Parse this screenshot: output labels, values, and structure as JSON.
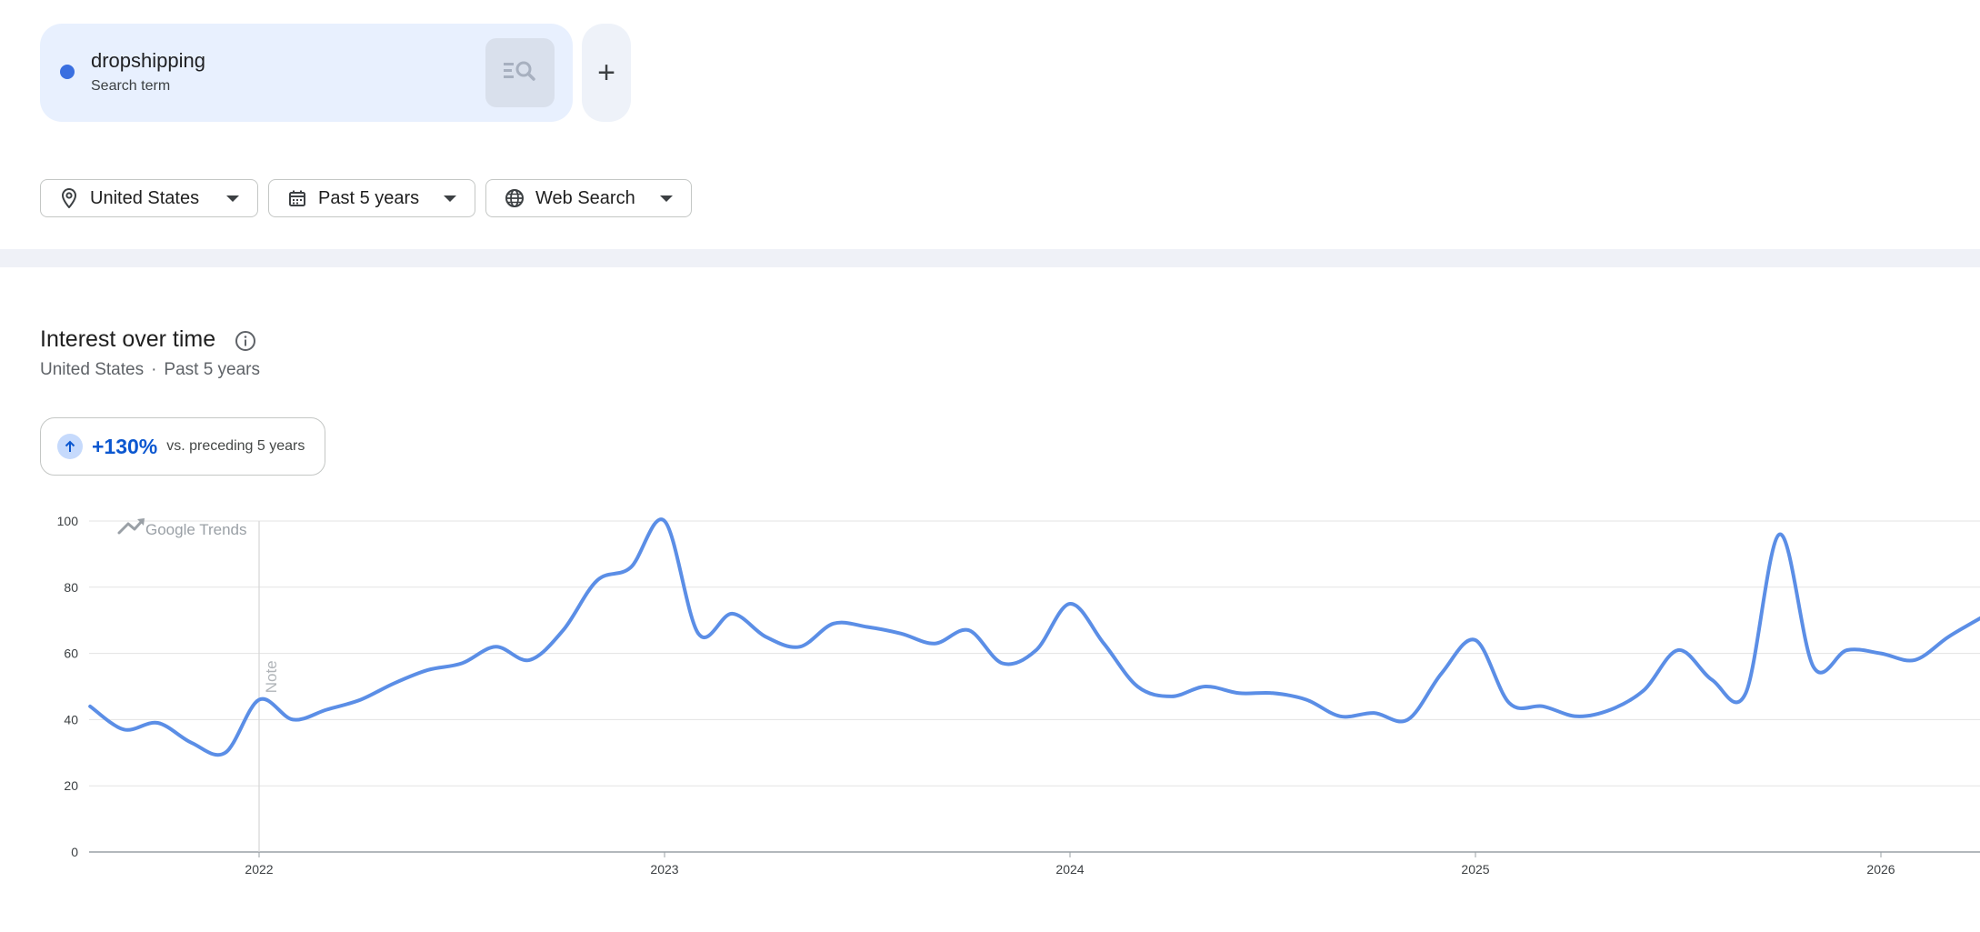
{
  "search_term": {
    "name": "dropshipping",
    "type": "Search term",
    "color": "#3a6fe0",
    "search_icon": "search-list-icon",
    "add_label": "+"
  },
  "filters": {
    "location": {
      "label": "United States",
      "icon": "location-pin-icon"
    },
    "time_range": {
      "label": "Past 5 years",
      "icon": "calendar-icon"
    },
    "property": {
      "label": "Web Search",
      "icon": "globe-icon"
    }
  },
  "interest_over_time": {
    "title": "Interest over time",
    "subtitle_location": "United States",
    "subtitle_separator": "·",
    "subtitle_range": "Past 5 years",
    "change_value": "+130%",
    "change_label": "vs. preceding 5 years"
  },
  "chart_data": {
    "type": "line",
    "watermark": "Google Trends",
    "note_label": "Note",
    "note_x": "2022",
    "ylim": [
      0,
      100
    ],
    "y_ticks": [
      0,
      20,
      40,
      60,
      80,
      100
    ],
    "x_ticks": [
      "2022",
      "2023",
      "2024",
      "2025",
      "2026"
    ],
    "grid": true,
    "series": [
      {
        "color": "#5b8ee6",
        "x": [
          "2021-08",
          "2021-09",
          "2021-10",
          "2021-11",
          "2021-12",
          "2022-01",
          "2022-02",
          "2022-03",
          "2022-04",
          "2022-05",
          "2022-06",
          "2022-07",
          "2022-08",
          "2022-09",
          "2022-10",
          "2022-11",
          "2022-12",
          "2023-01",
          "2023-02",
          "2023-03",
          "2023-04",
          "2023-05",
          "2023-06",
          "2023-07",
          "2023-08",
          "2023-09",
          "2023-10",
          "2023-11",
          "2023-12",
          "2024-01",
          "2024-02",
          "2024-03",
          "2024-04",
          "2024-05",
          "2024-06",
          "2024-07",
          "2024-08",
          "2024-09",
          "2024-10",
          "2024-11",
          "2024-12",
          "2025-01",
          "2025-02",
          "2025-03",
          "2025-04",
          "2025-05",
          "2025-06",
          "2025-07",
          "2025-08",
          "2025-09",
          "2025-10",
          "2025-11",
          "2025-12",
          "2026-01",
          "2026-02",
          "2026-03",
          "2026-04"
        ],
        "values": [
          44,
          37,
          39,
          33,
          30,
          46,
          40,
          43,
          46,
          51,
          55,
          57,
          62,
          58,
          67,
          82,
          86,
          100,
          66,
          72,
          65,
          62,
          69,
          68,
          66,
          63,
          67,
          57,
          61,
          75,
          63,
          50,
          47,
          50,
          48,
          48,
          46,
          41,
          42,
          40,
          54,
          64,
          45,
          44,
          41,
          43,
          49,
          61,
          52,
          48,
          96,
          56,
          61,
          60,
          58,
          65,
          71
        ]
      }
    ]
  }
}
